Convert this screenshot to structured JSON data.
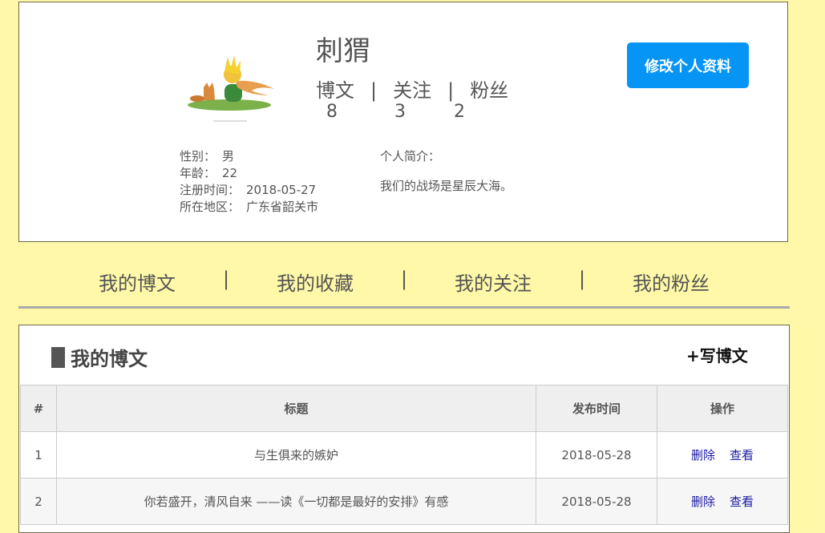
{
  "profile": {
    "username": "刺猬",
    "stats": [
      {
        "label": "博文",
        "count": "8"
      },
      {
        "label": "关注",
        "count": "3"
      },
      {
        "label": "粉丝",
        "count": "2"
      }
    ],
    "stat_separator": "|",
    "edit_button": "修改个人资料",
    "info": [
      {
        "label": "性别：",
        "value": "男"
      },
      {
        "label": "年龄：",
        "value": "22"
      },
      {
        "label": "注册时间：",
        "value": "2018-05-27"
      },
      {
        "label": "所在地区：",
        "value": "广东省韶关市"
      }
    ],
    "bio_label": "个人简介：",
    "bio_text": "我们的战场是星辰大海。"
  },
  "nav": {
    "items": [
      "我的博文",
      "我的收藏",
      "我的关注",
      "我的粉丝"
    ],
    "separator": "|"
  },
  "posts": {
    "title": "我的博文",
    "write_button": "+写博文",
    "columns": [
      "#",
      "标题",
      "发布时间",
      "操作"
    ],
    "rows": [
      {
        "index": "1",
        "title": "与生俱来的嫉妒",
        "date": "2018-05-28",
        "delete": "删除",
        "view": "查看"
      },
      {
        "index": "2",
        "title": "你若盛开，清风自来 ——读《一切都是最好的安排》有感",
        "date": "2018-05-28",
        "delete": "删除",
        "view": "查看"
      }
    ]
  },
  "colors": {
    "page_background": "#fef8a8",
    "primary_button": "#0795f5",
    "link": "#1a1aa6"
  }
}
